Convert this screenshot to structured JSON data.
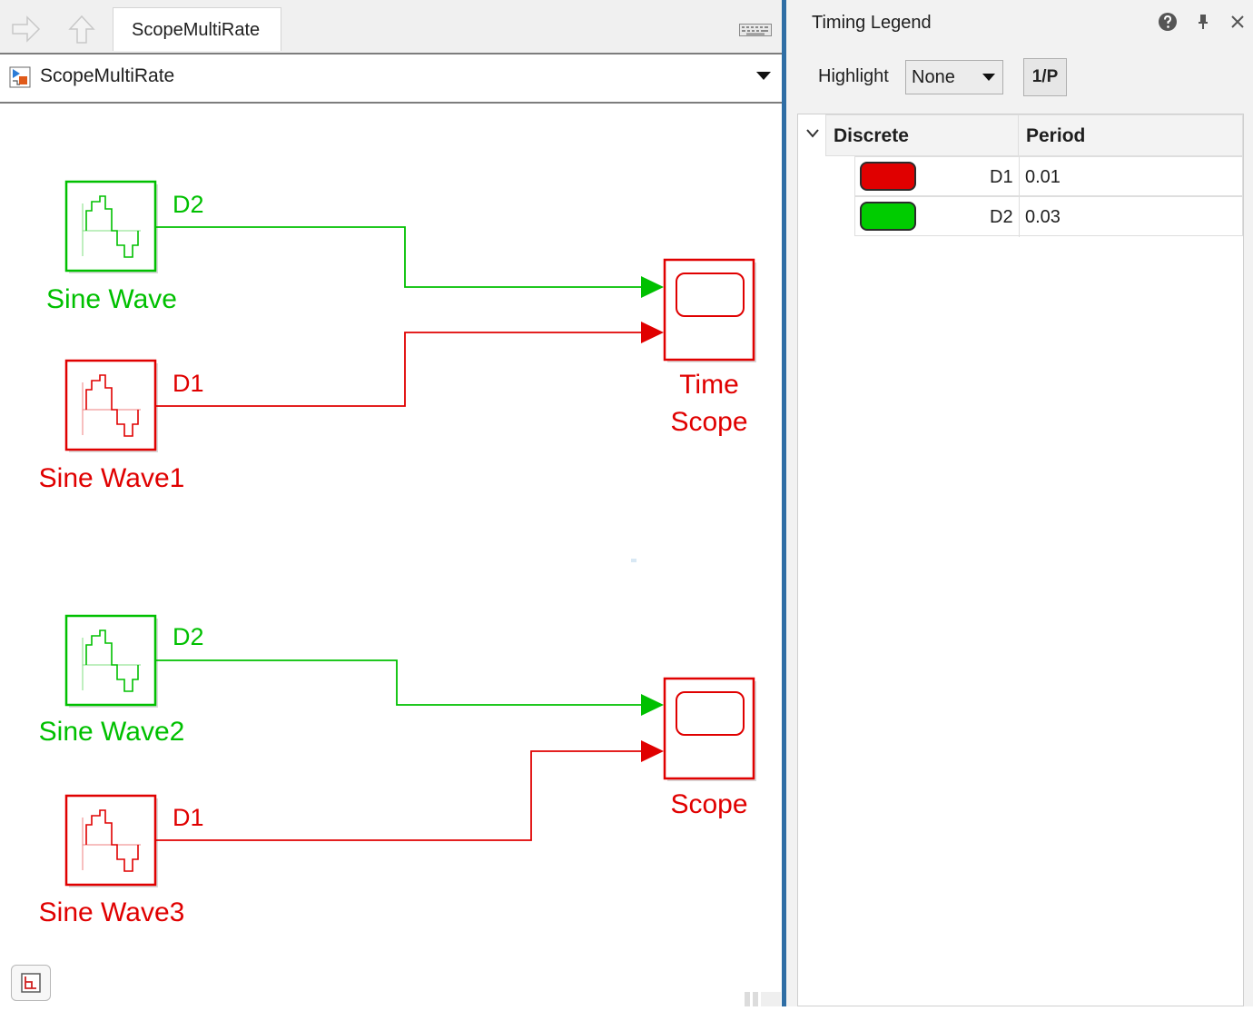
{
  "editor": {
    "tab_label": "ScopeMultiRate",
    "breadcrumb": "ScopeMultiRate"
  },
  "diagram": {
    "blocks": {
      "sine_wave": "Sine Wave",
      "sine_wave1": "Sine Wave1",
      "sine_wave2": "Sine Wave2",
      "sine_wave3": "Sine Wave3",
      "time_scope_line1": "Time",
      "time_scope_line2": "Scope",
      "scope": "Scope"
    },
    "signals": {
      "sig1": "D2",
      "sig2": "D1",
      "sig3": "D2",
      "sig4": "D1"
    }
  },
  "legend": {
    "title": "Timing Legend",
    "highlight_label": "Highlight",
    "highlight_value": "None",
    "reciprocal_button": "1/P",
    "column_discrete": "Discrete",
    "column_period": "Period",
    "rates": [
      {
        "name": "D1",
        "period": "0.01",
        "color": "#e00000"
      },
      {
        "name": "D2",
        "period": "0.03",
        "color": "#00cc00"
      }
    ]
  },
  "colors": {
    "rate_d1": "#e00000",
    "rate_d2": "#00cc00",
    "splitter": "#2f6ea5"
  }
}
